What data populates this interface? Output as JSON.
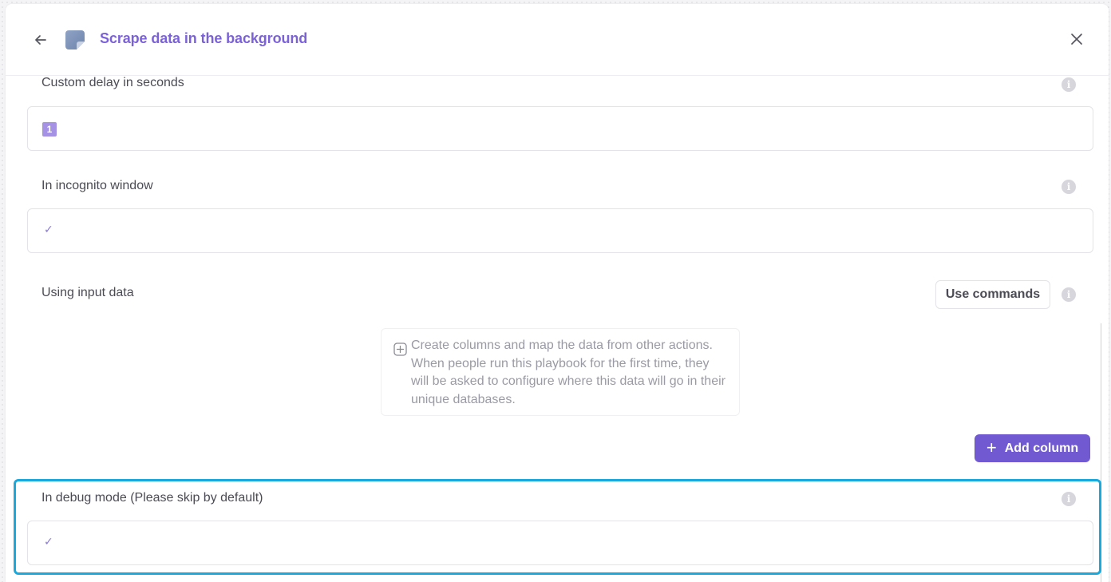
{
  "header": {
    "title": "Scrape data in the background",
    "back_icon": "arrow-left-icon",
    "logo_icon": "scraper-app-icon",
    "close_icon": "close-icon"
  },
  "fields": {
    "custom_delay": {
      "label": "Custom delay in seconds",
      "value": "1"
    },
    "incognito": {
      "label": "In incognito window",
      "value": "✓"
    },
    "input_data": {
      "label": "Using input data",
      "use_commands_label": "Use commands",
      "empty_hint": "Create columns and map the data from other actions. When people run this playbook for the first time, they will be asked to configure where this data will go in their unique databases.",
      "add_column_label": "Add column"
    },
    "debug_mode": {
      "label": "In debug mode (Please skip by default)",
      "value": "✓"
    }
  },
  "colors": {
    "accent": "#7159d2",
    "title": "#7b62d6",
    "highlight": "#1aa9dc"
  }
}
